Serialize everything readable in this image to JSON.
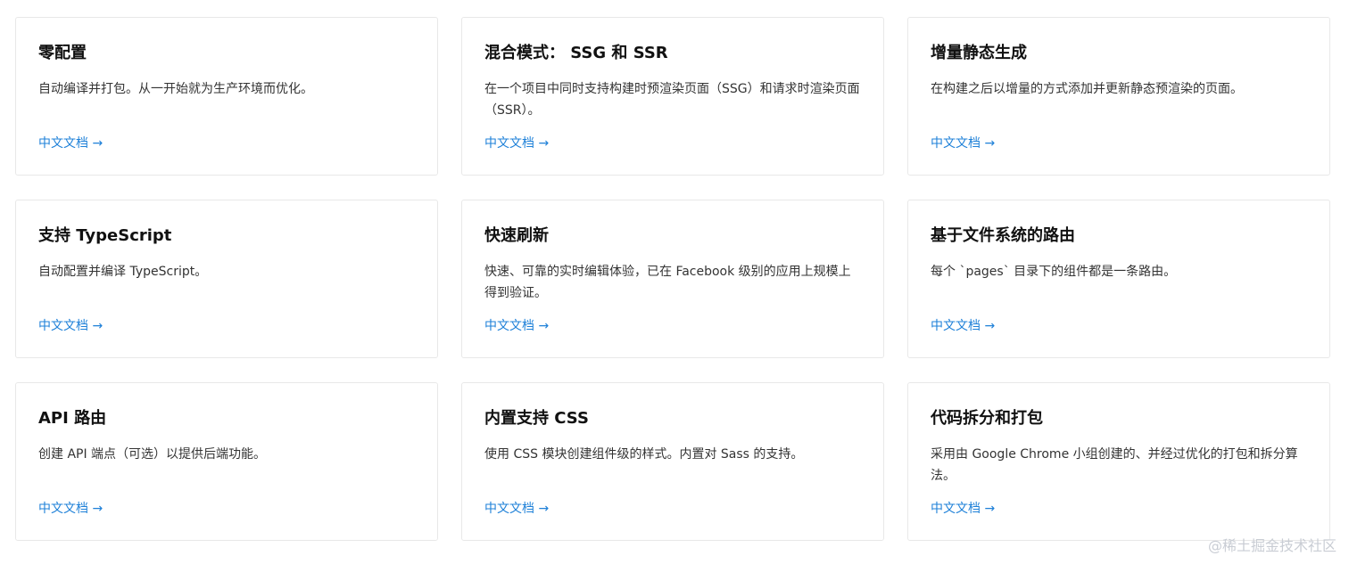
{
  "cards": [
    {
      "title": "零配置",
      "desc": "自动编译并打包。从一开始就为生产环境而优化。",
      "link": "中文文档 →"
    },
    {
      "title": "混合模式： SSG 和 SSR",
      "desc": "在一个项目中同时支持构建时预渲染页面（SSG）和请求时渲染页面（SSR）。",
      "link": "中文文档 →"
    },
    {
      "title": "增量静态生成",
      "desc": "在构建之后以增量的方式添加并更新静态预渲染的页面。",
      "link": "中文文档 →"
    },
    {
      "title": "支持 TypeScript",
      "desc": "自动配置并编译 TypeScript。",
      "link": "中文文档 →"
    },
    {
      "title": "快速刷新",
      "desc": "快速、可靠的实时编辑体验，已在 Facebook 级别的应用上规模上得到验证。",
      "link": "中文文档 →"
    },
    {
      "title": "基于文件系统的路由",
      "desc": "每个 `pages` 目录下的组件都是一条路由。",
      "link": "中文文档 →"
    },
    {
      "title": "API 路由",
      "desc": "创建 API 端点（可选）以提供后端功能。",
      "link": "中文文档 →"
    },
    {
      "title": "内置支持 CSS",
      "desc": "使用 CSS 模块创建组件级的样式。内置对 Sass 的支持。",
      "link": "中文文档 →"
    },
    {
      "title": "代码拆分和打包",
      "desc": "采用由 Google Chrome 小组创建的、并经过优化的打包和拆分算法。",
      "link": "中文文档 →"
    }
  ],
  "watermark": "@稀土掘金技术社区",
  "colors": {
    "link": "#1e80d8",
    "border": "#e8e8e8",
    "title": "#111111",
    "text": "#333333"
  }
}
